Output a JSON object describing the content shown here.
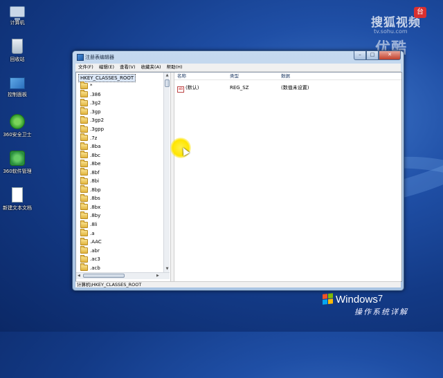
{
  "desktop": {
    "icons": [
      {
        "label": "计算机",
        "icon": "computer-icon"
      },
      {
        "label": "回收站",
        "icon": "recycle-bin-icon"
      },
      {
        "label": "控制面板",
        "icon": "control-panel-icon"
      },
      {
        "label": "360安全卫士",
        "icon": "shield-360-icon"
      },
      {
        "label": "360软件管理",
        "icon": "software-manager-icon"
      },
      {
        "label": "新建文本文档",
        "icon": "text-document-icon"
      }
    ],
    "watermark": {
      "line1": "搜狐视频",
      "line2": "tv.sohu.com",
      "line3": "优酷",
      "badge": "台"
    },
    "brand": {
      "windows": "Windows",
      "version": "7",
      "subtitle": "操作系统详解"
    }
  },
  "window": {
    "title": "注册表编辑器",
    "buttons": {
      "minimize": "–",
      "maximize": "□",
      "close": "✕"
    },
    "menu": [
      "文件(F)",
      "编辑(E)",
      "查看(V)",
      "收藏夹(A)",
      "帮助(H)"
    ],
    "tree": {
      "root": "HKEY_CLASSES_ROOT",
      "items": [
        "*",
        ".386",
        ".3g2",
        ".3gp",
        ".3gp2",
        ".3gpp",
        ".7z",
        ".8ba",
        ".8bc",
        ".8be",
        ".8bf",
        ".8bi",
        ".8bp",
        ".8bs",
        ".8bx",
        ".8by",
        ".8li",
        ".a",
        ".AAC",
        ".abr",
        ".ac3",
        ".acb"
      ]
    },
    "list": {
      "columns": [
        "名称",
        "类型",
        "数据"
      ],
      "rows": [
        {
          "icon": "ab",
          "name": "(默认)",
          "type": "REG_SZ",
          "data": "(数值未设置)"
        }
      ]
    },
    "status": "计算机\\HKEY_CLASSES_ROOT"
  },
  "colors": {
    "accent": "#1f4fa6",
    "close": "#c2412c",
    "highlight": "#ffe500"
  }
}
